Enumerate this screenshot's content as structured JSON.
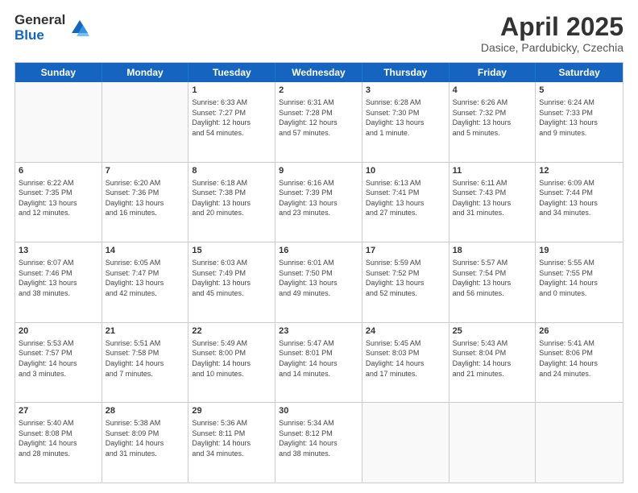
{
  "header": {
    "logo_general": "General",
    "logo_blue": "Blue",
    "month_title": "April 2025",
    "subtitle": "Dasice, Pardubicky, Czechia"
  },
  "calendar": {
    "days": [
      "Sunday",
      "Monday",
      "Tuesday",
      "Wednesday",
      "Thursday",
      "Friday",
      "Saturday"
    ],
    "rows": [
      [
        {
          "day": "",
          "info": ""
        },
        {
          "day": "",
          "info": ""
        },
        {
          "day": "1",
          "info": "Sunrise: 6:33 AM\nSunset: 7:27 PM\nDaylight: 12 hours\nand 54 minutes."
        },
        {
          "day": "2",
          "info": "Sunrise: 6:31 AM\nSunset: 7:28 PM\nDaylight: 12 hours\nand 57 minutes."
        },
        {
          "day": "3",
          "info": "Sunrise: 6:28 AM\nSunset: 7:30 PM\nDaylight: 13 hours\nand 1 minute."
        },
        {
          "day": "4",
          "info": "Sunrise: 6:26 AM\nSunset: 7:32 PM\nDaylight: 13 hours\nand 5 minutes."
        },
        {
          "day": "5",
          "info": "Sunrise: 6:24 AM\nSunset: 7:33 PM\nDaylight: 13 hours\nand 9 minutes."
        }
      ],
      [
        {
          "day": "6",
          "info": "Sunrise: 6:22 AM\nSunset: 7:35 PM\nDaylight: 13 hours\nand 12 minutes."
        },
        {
          "day": "7",
          "info": "Sunrise: 6:20 AM\nSunset: 7:36 PM\nDaylight: 13 hours\nand 16 minutes."
        },
        {
          "day": "8",
          "info": "Sunrise: 6:18 AM\nSunset: 7:38 PM\nDaylight: 13 hours\nand 20 minutes."
        },
        {
          "day": "9",
          "info": "Sunrise: 6:16 AM\nSunset: 7:39 PM\nDaylight: 13 hours\nand 23 minutes."
        },
        {
          "day": "10",
          "info": "Sunrise: 6:13 AM\nSunset: 7:41 PM\nDaylight: 13 hours\nand 27 minutes."
        },
        {
          "day": "11",
          "info": "Sunrise: 6:11 AM\nSunset: 7:43 PM\nDaylight: 13 hours\nand 31 minutes."
        },
        {
          "day": "12",
          "info": "Sunrise: 6:09 AM\nSunset: 7:44 PM\nDaylight: 13 hours\nand 34 minutes."
        }
      ],
      [
        {
          "day": "13",
          "info": "Sunrise: 6:07 AM\nSunset: 7:46 PM\nDaylight: 13 hours\nand 38 minutes."
        },
        {
          "day": "14",
          "info": "Sunrise: 6:05 AM\nSunset: 7:47 PM\nDaylight: 13 hours\nand 42 minutes."
        },
        {
          "day": "15",
          "info": "Sunrise: 6:03 AM\nSunset: 7:49 PM\nDaylight: 13 hours\nand 45 minutes."
        },
        {
          "day": "16",
          "info": "Sunrise: 6:01 AM\nSunset: 7:50 PM\nDaylight: 13 hours\nand 49 minutes."
        },
        {
          "day": "17",
          "info": "Sunrise: 5:59 AM\nSunset: 7:52 PM\nDaylight: 13 hours\nand 52 minutes."
        },
        {
          "day": "18",
          "info": "Sunrise: 5:57 AM\nSunset: 7:54 PM\nDaylight: 13 hours\nand 56 minutes."
        },
        {
          "day": "19",
          "info": "Sunrise: 5:55 AM\nSunset: 7:55 PM\nDaylight: 14 hours\nand 0 minutes."
        }
      ],
      [
        {
          "day": "20",
          "info": "Sunrise: 5:53 AM\nSunset: 7:57 PM\nDaylight: 14 hours\nand 3 minutes."
        },
        {
          "day": "21",
          "info": "Sunrise: 5:51 AM\nSunset: 7:58 PM\nDaylight: 14 hours\nand 7 minutes."
        },
        {
          "day": "22",
          "info": "Sunrise: 5:49 AM\nSunset: 8:00 PM\nDaylight: 14 hours\nand 10 minutes."
        },
        {
          "day": "23",
          "info": "Sunrise: 5:47 AM\nSunset: 8:01 PM\nDaylight: 14 hours\nand 14 minutes."
        },
        {
          "day": "24",
          "info": "Sunrise: 5:45 AM\nSunset: 8:03 PM\nDaylight: 14 hours\nand 17 minutes."
        },
        {
          "day": "25",
          "info": "Sunrise: 5:43 AM\nSunset: 8:04 PM\nDaylight: 14 hours\nand 21 minutes."
        },
        {
          "day": "26",
          "info": "Sunrise: 5:41 AM\nSunset: 8:06 PM\nDaylight: 14 hours\nand 24 minutes."
        }
      ],
      [
        {
          "day": "27",
          "info": "Sunrise: 5:40 AM\nSunset: 8:08 PM\nDaylight: 14 hours\nand 28 minutes."
        },
        {
          "day": "28",
          "info": "Sunrise: 5:38 AM\nSunset: 8:09 PM\nDaylight: 14 hours\nand 31 minutes."
        },
        {
          "day": "29",
          "info": "Sunrise: 5:36 AM\nSunset: 8:11 PM\nDaylight: 14 hours\nand 34 minutes."
        },
        {
          "day": "30",
          "info": "Sunrise: 5:34 AM\nSunset: 8:12 PM\nDaylight: 14 hours\nand 38 minutes."
        },
        {
          "day": "",
          "info": ""
        },
        {
          "day": "",
          "info": ""
        },
        {
          "day": "",
          "info": ""
        }
      ]
    ]
  }
}
